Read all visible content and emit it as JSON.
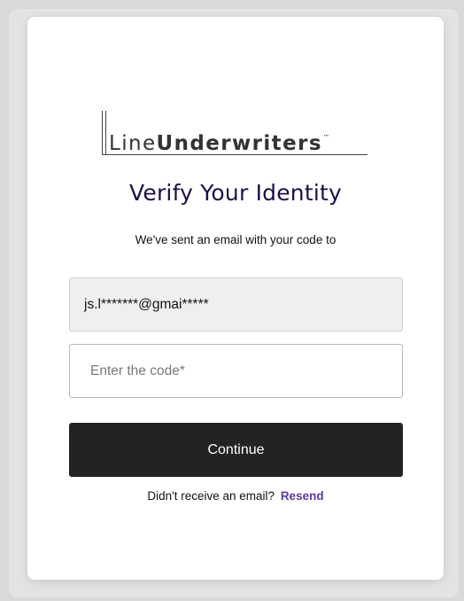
{
  "logo": {
    "regular": "Line",
    "bold": "Underwriters",
    "trademark": "™"
  },
  "title": "Verify Your Identity",
  "subtitle": "We've sent an email with your code to",
  "email_field": {
    "value": "js.l*******@gmai*****"
  },
  "code_field": {
    "placeholder": "Enter the code*",
    "value": ""
  },
  "continue_button": {
    "label": "Continue"
  },
  "resend": {
    "prompt": "Didn't receive an email?",
    "link_label": "Resend"
  },
  "colors": {
    "title": "#1f0f4a",
    "button_bg": "#232323",
    "link": "#5c3aa3"
  }
}
